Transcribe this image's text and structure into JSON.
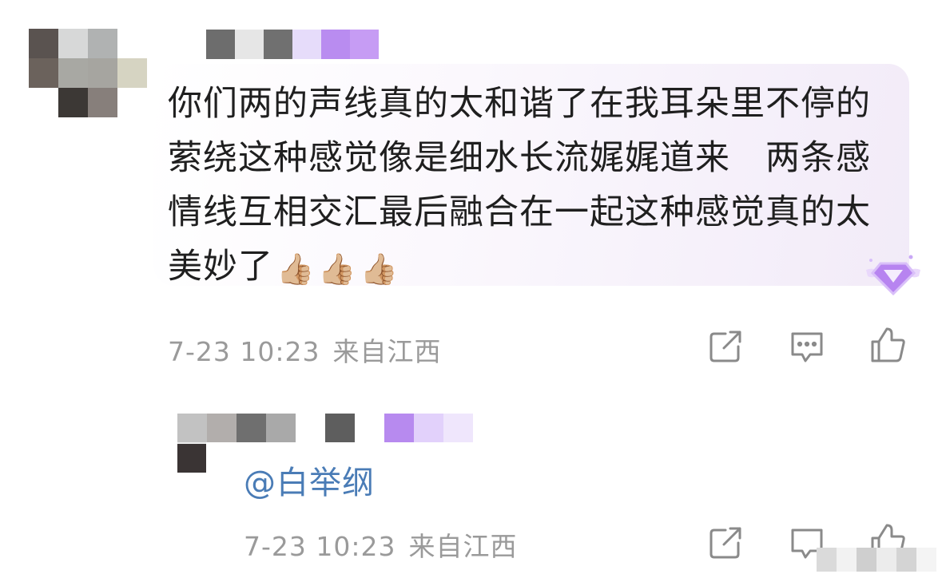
{
  "comment": {
    "text": "你们两的声线真的太和谐了在我耳朵里不停的萦绕这种感觉像是细水长流娓娓道来　两条感情线互相交汇最后融合在一起这种感觉真的太美妙了",
    "emojis": [
      "👍🏼",
      "👍🏼",
      "👍🏼"
    ],
    "date": "7-23 10:23",
    "location": "来自江西"
  },
  "reply": {
    "mention": "@白举纲",
    "date": "7-23 10:23",
    "location": "来自江西"
  },
  "icons": {
    "share": "share-icon",
    "comment": "comment-icon",
    "like": "thumbs-up-icon",
    "badge": "purple-diamond-badge-icon"
  },
  "colors": {
    "meta": "#9a9a9a",
    "mention": "#4a7cb6",
    "badge": "#b784f0",
    "bubble_tint": "#f2ebf8"
  }
}
